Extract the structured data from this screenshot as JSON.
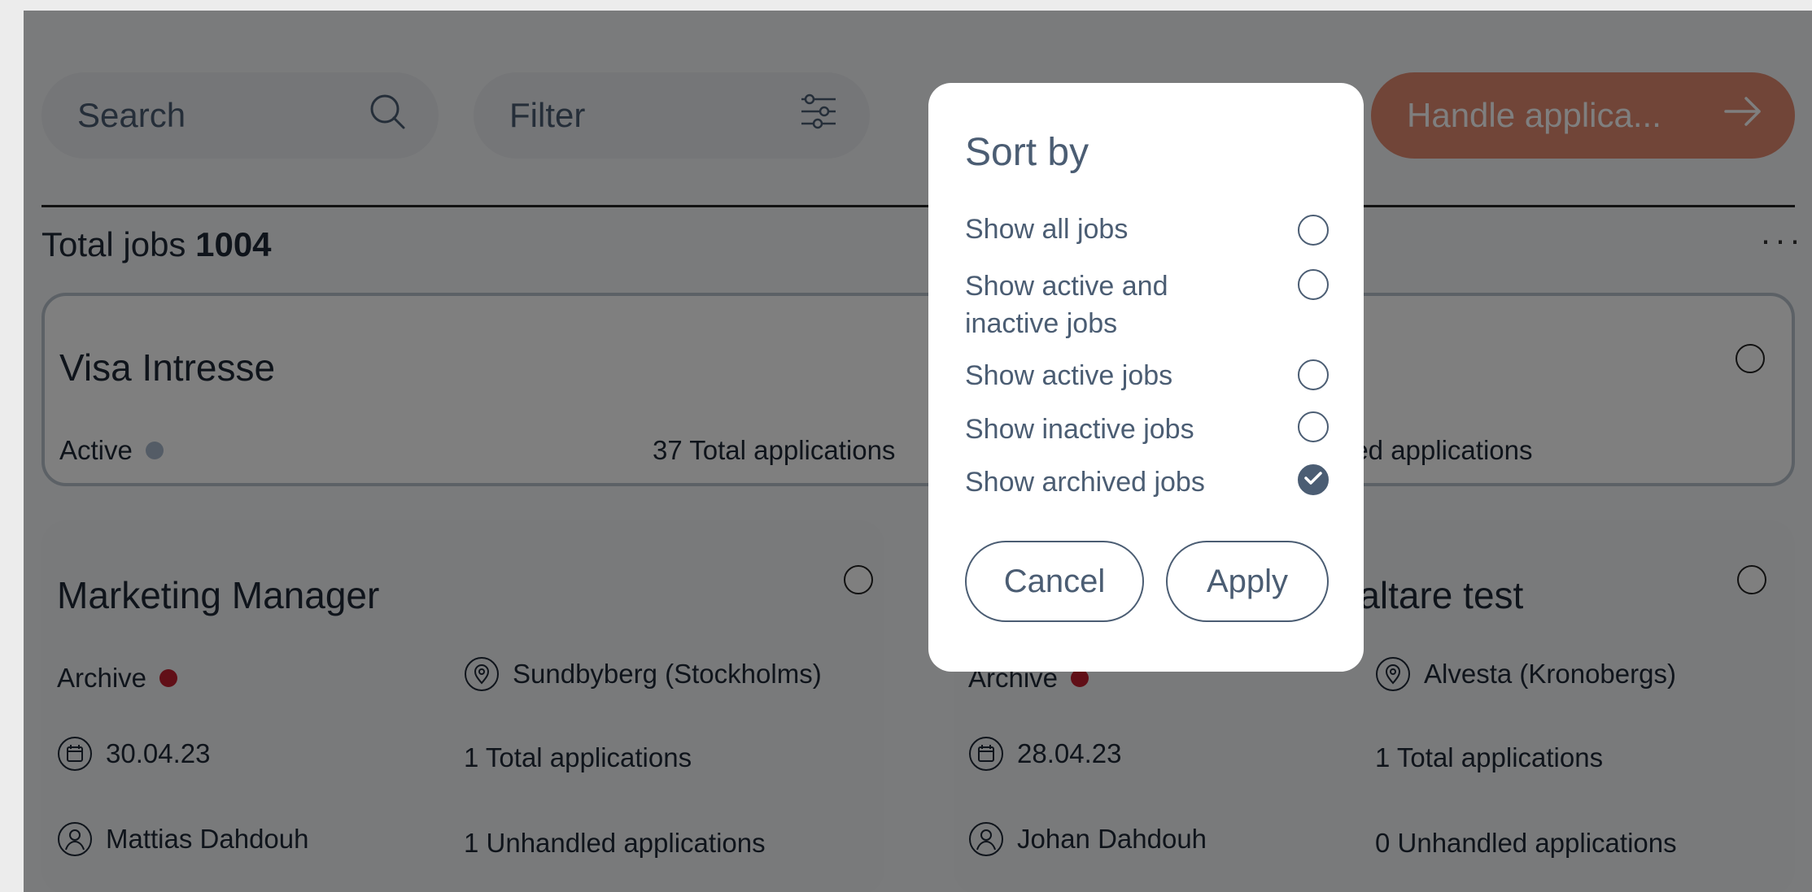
{
  "toolbar": {
    "search_placeholder": "Search",
    "filter_label": "Filter",
    "handle_label": "Handle applica..."
  },
  "summary": {
    "total_label": "Total jobs",
    "total_count": "1004",
    "more": "···"
  },
  "cards": {
    "visa": {
      "title": "Visa Intresse",
      "status": "Active",
      "total_applications": "37 Total applications",
      "unhandled_partial": "led applications"
    },
    "marketing": {
      "title": "Marketing Manager",
      "status": "Archive",
      "location": "Sundbyberg (Stockholms)",
      "date": "30.04.23",
      "total_applications": "1 Total applications",
      "owner": "Mattias Dahdouh",
      "unhandled_applications": "1 Unhandled applications"
    },
    "right": {
      "title_partial": "rvaltare test",
      "status": "Archive",
      "location": "Alvesta (Kronobergs)",
      "date": "28.04.23",
      "total_applications": "1 Total applications",
      "owner": "Johan Dahdouh",
      "unhandled_applications": "0 Unhandled applications"
    }
  },
  "sort_modal": {
    "title": "Sort by",
    "options": [
      {
        "label": "Show all jobs",
        "checked": false
      },
      {
        "label": "Show active and inactive jobs",
        "checked": false
      },
      {
        "label": "Show active jobs",
        "checked": false
      },
      {
        "label": "Show inactive jobs",
        "checked": false
      },
      {
        "label": "Show archived jobs",
        "checked": true
      }
    ],
    "cancel_label": "Cancel",
    "apply_label": "Apply"
  },
  "colors": {
    "accent": "#e38a71",
    "text": "#4b5d73",
    "archive_dot": "#c21f2f",
    "active_dot": "#a9b9cc",
    "overlay": "rgba(0,0,0,0.5)"
  },
  "icons": {
    "search": "search-icon",
    "filter": "sliders-icon",
    "arrow": "arrow-right-icon",
    "location": "location-pin-icon",
    "calendar": "calendar-icon",
    "user": "user-icon",
    "check": "check-icon"
  }
}
